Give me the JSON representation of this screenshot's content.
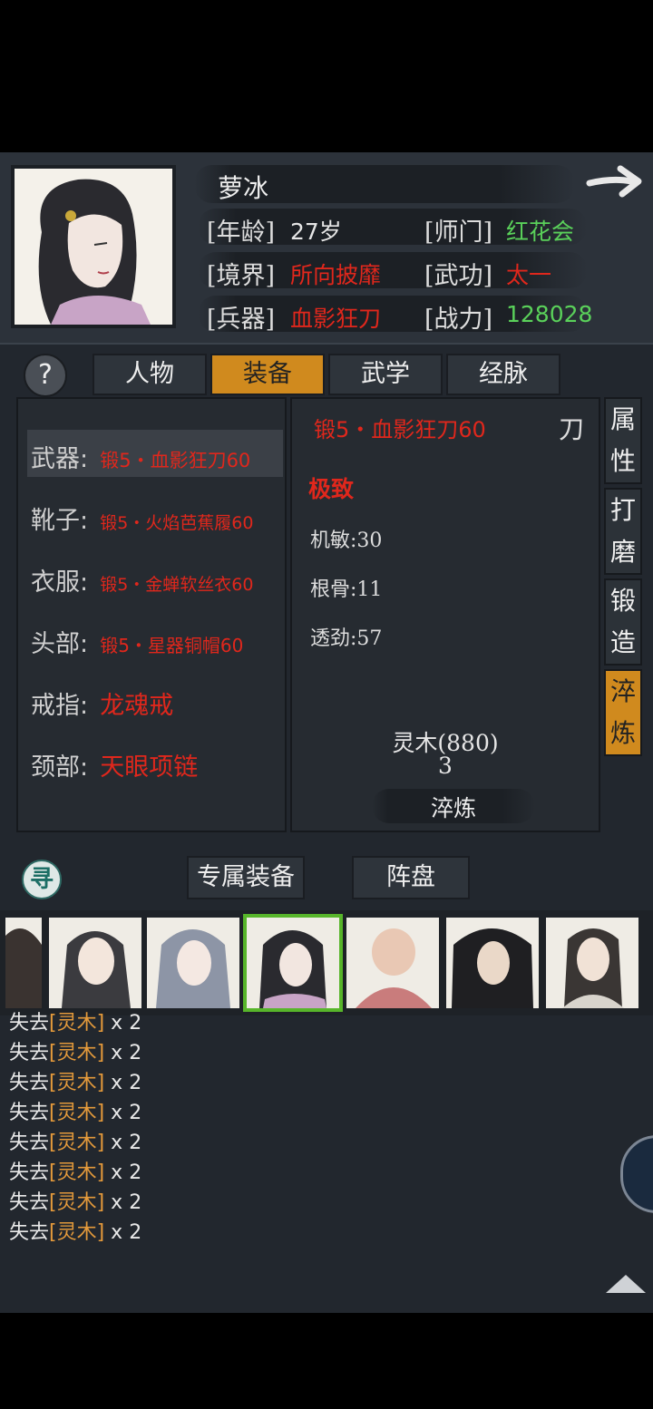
{
  "character": {
    "name": "萝冰",
    "rows": [
      {
        "label1": "[年龄]",
        "value1": "27岁",
        "label2": "[师门]",
        "value2": "红花会"
      },
      {
        "label1": "[境界]",
        "value1": "所向披靡",
        "label2": "[武功]",
        "value2": "太一"
      },
      {
        "label1": "[兵器]",
        "value1": "血影狂刀",
        "label2": "[战力]",
        "value2": "128028"
      }
    ]
  },
  "tabs": [
    "人物",
    "装备",
    "武学",
    "经脉"
  ],
  "active_tab": "装备",
  "equipment": [
    {
      "slot": "武器:",
      "item": "锻5・血影狂刀60"
    },
    {
      "slot": "靴子:",
      "item": "锻5・火焰芭蕉履60"
    },
    {
      "slot": "衣服:",
      "item": "锻5・金蝉软丝衣60"
    },
    {
      "slot": "头部:",
      "item": "锻5・星器铜帽60"
    },
    {
      "slot": "戒指:",
      "item": "龙魂戒"
    },
    {
      "slot": "颈部:",
      "item": "天眼项链"
    }
  ],
  "detail": {
    "title": "锻5・血影狂刀60",
    "type": "刀",
    "quality": "极致",
    "stats": [
      "机敏:30",
      "根骨:11",
      "透劲:57"
    ],
    "material": "灵木(880)",
    "material_cost": "3",
    "action": "淬炼"
  },
  "side_tabs": [
    {
      "line1": "属",
      "line2": "性"
    },
    {
      "line1": "打",
      "line2": "磨"
    },
    {
      "line1": "锻",
      "line2": "造"
    },
    {
      "line1": "淬",
      "line2": "炼"
    }
  ],
  "lower_tabs": [
    "专属装备",
    "阵盘"
  ],
  "search_icon_glyph": "寻",
  "help_icon_glyph": "?",
  "log": [
    {
      "prefix": "失去",
      "item": "[灵木]",
      "suffix": " x 2"
    },
    {
      "prefix": "失去",
      "item": "[灵木]",
      "suffix": " x 2"
    },
    {
      "prefix": "失去",
      "item": "[灵木]",
      "suffix": " x 2"
    },
    {
      "prefix": "失去",
      "item": "[灵木]",
      "suffix": " x 2"
    },
    {
      "prefix": "失去",
      "item": "[灵木]",
      "suffix": " x 2"
    },
    {
      "prefix": "失去",
      "item": "[灵木]",
      "suffix": " x 2"
    },
    {
      "prefix": "失去",
      "item": "[灵木]",
      "suffix": " x 2"
    },
    {
      "prefix": "失去",
      "item": "[灵木]",
      "suffix": " x 2"
    }
  ],
  "colors": {
    "accent_tab": "#d08a1e",
    "value_red": "#e0271c",
    "value_green": "#5ad15a",
    "log_item": "#e49a3b",
    "selected_outline": "#57b52a"
  }
}
